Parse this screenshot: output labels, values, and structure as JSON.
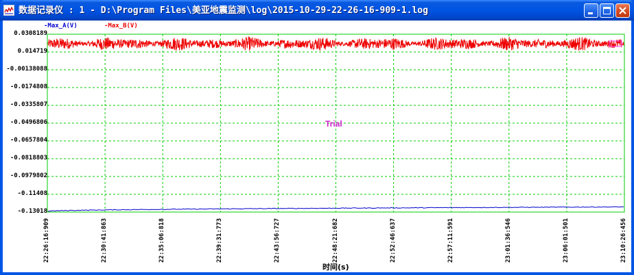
{
  "window": {
    "title": "数据记录仪 : 1 - D:\\Program Files\\美亚地震监测\\log\\2015-10-29-22-26-16-909-1.log",
    "icon": "chart-window-icon",
    "buttons": [
      "minimize-icon",
      "maximize-icon",
      "close-icon"
    ]
  },
  "legend": [
    {
      "label": "-Max_A(V)",
      "color": "#0000cc"
    },
    {
      "label": "-Max_B(V)",
      "color": "#ee0000"
    }
  ],
  "watermark": "Trial",
  "chart_data": {
    "type": "line",
    "xlabel": "时间(s)",
    "ylabel": "",
    "x_ticks": [
      "22:26:16:909",
      "22:30:41:863",
      "22:35:06:818",
      "22:39:31:773",
      "22:43:56:727",
      "22:48:21:682",
      "22:52:46:637",
      "22:57:11:591",
      "23:01:36:546",
      "23:06:01:501",
      "23:10:26:456"
    ],
    "y_ticks": [
      "0.0308189",
      "0.014719",
      "-0.00138088",
      "-0.0174808",
      "-0.0335807",
      "-0.0496806",
      "-0.0657804",
      "-0.0818803",
      "-0.0979802",
      "-0.11408",
      "-0.13018"
    ],
    "ylim": [
      -0.13018,
      0.0308189
    ],
    "grid": true,
    "grid_color": "#00cc00",
    "plot_bg": "#ffffff",
    "series": [
      {
        "name": "-Max_A(V)",
        "color": "#0000cc",
        "start": -0.1295,
        "end": -0.1255,
        "noise": 0.0003
      },
      {
        "name": "-Max_B(V)",
        "color": "#ee0000",
        "center": 0.0222,
        "amplitude": 0.004
      }
    ]
  }
}
